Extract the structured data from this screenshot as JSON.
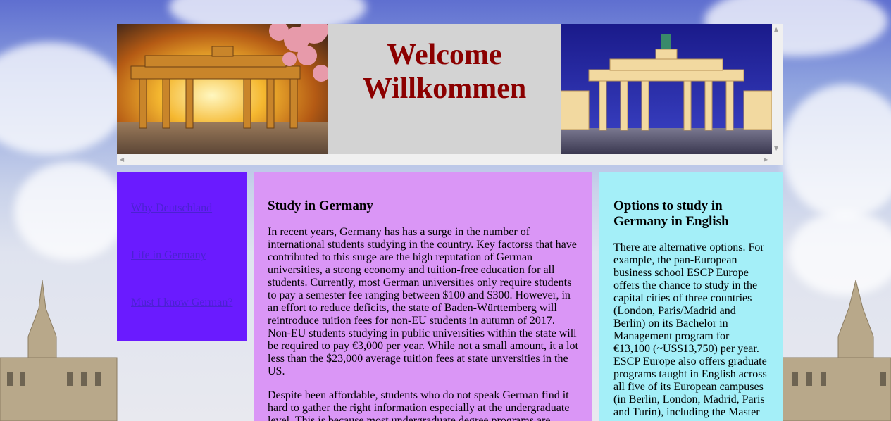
{
  "colors": {
    "header_title": "#8b0000",
    "header_center_bg": "#d3d3d3",
    "nav_bg": "#6a1bff",
    "nav_link": "#4b22d1",
    "main_bg": "#da96f6",
    "aside_bg": "#a4eff8"
  },
  "header": {
    "title_line1": "Welcome",
    "title_line2": "Willkommen",
    "left_image_icon": "brandenburg-gate-sunset-image",
    "right_image_icon": "brandenburg-gate-night-image"
  },
  "nav": {
    "links": [
      {
        "label": "Why Deutschland"
      },
      {
        "label": "Life in Germany"
      },
      {
        "label": "Must I know German?"
      }
    ]
  },
  "main": {
    "heading": "Study in Germany",
    "paragraphs": [
      "In recent years, Germany has has a surge in the number of international students studying in the country. Key factorss that have contributed to this surge are the high reputation of German universities, a strong economy and tuition-free education for all students. Currently, most German universities only require students to pay a semester fee ranging between $100 and $300. However, in an effort to reduce deficits, the state of Baden-Württemberg will reintroduce tuition fees for non-EU students in autumn of 2017. Non-EU students studying in public universities within the state will be required to pay €3,000 per year. While not a small amount, it a lot less than the $23,000 average tuition fees at state unversities in the US.",
      "Despite been affordable, students who do not speak German find it hard to gather the right information especially at the undergraduate level. This is because most undergraduate degree programs are"
    ]
  },
  "aside": {
    "heading": "Options to study in Germany in English",
    "paragraph": "There are alternative options. For example, the pan-European business school ESCP Europe offers the chance to study in the capital cities of three countries (London, Paris/Madrid and Berlin) on its Bachelor in Management program for €13,100 (~US$13,750) per year. ESCP Europe also offers graduate programs taught in English across all five of its European campuses (in Berlin, London, Madrid, Paris and Turin), including the Master"
  }
}
